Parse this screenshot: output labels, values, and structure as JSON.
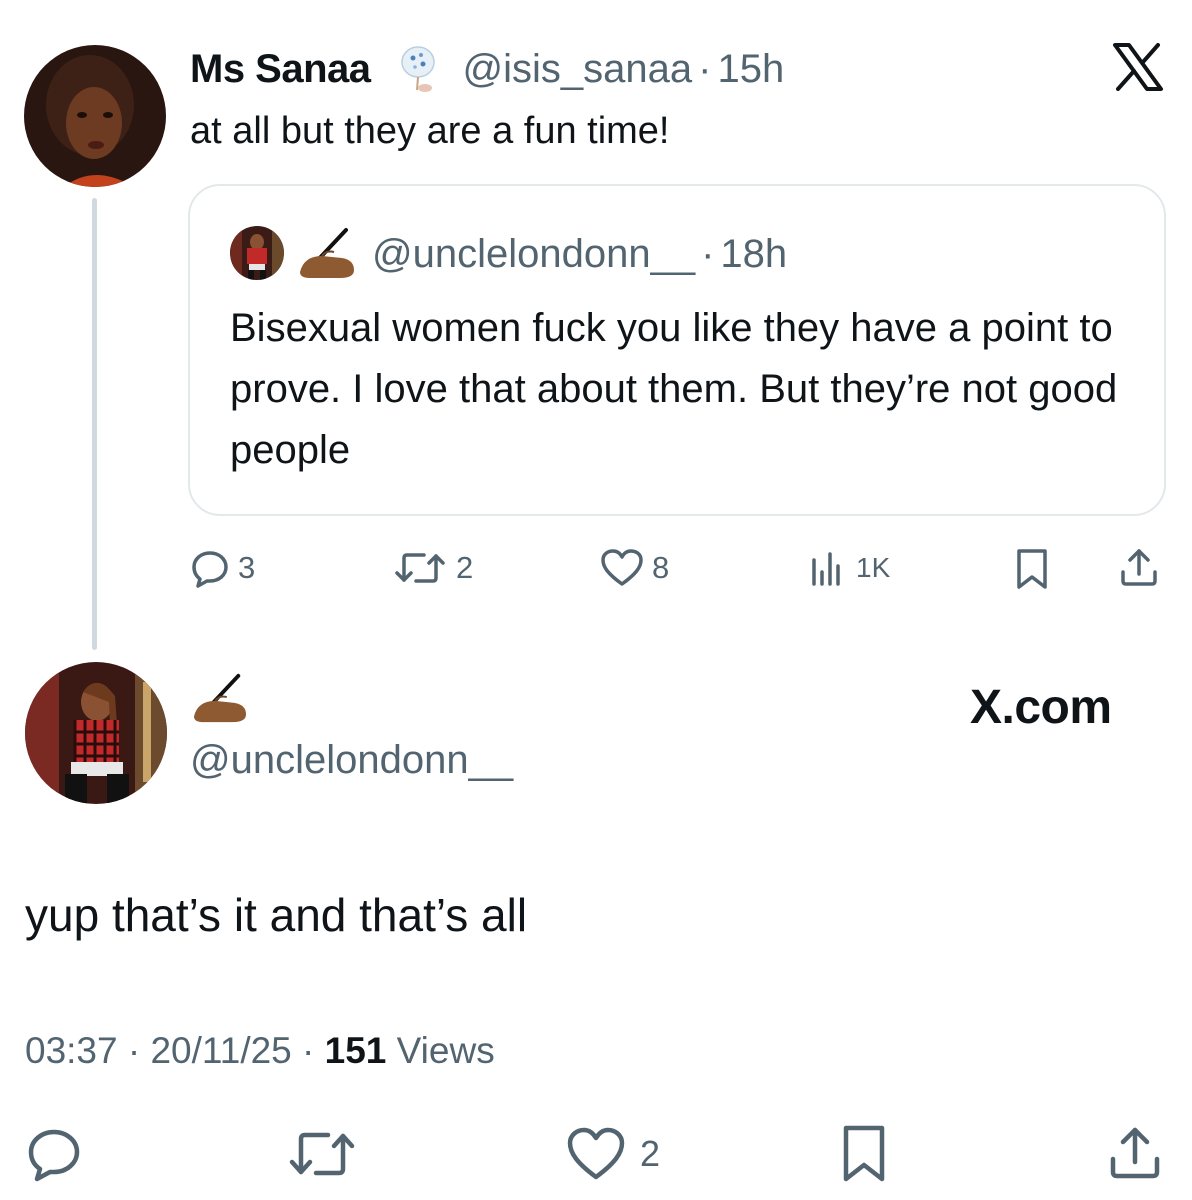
{
  "top_tweet": {
    "display_name": "Ms Sanaa",
    "handle": "@isis_sanaa",
    "time": "15h",
    "text": "at all but they are a fun time!",
    "badge_icon": "porcelain-figure-emoji",
    "quote": {
      "name_icon": "writing-hand-emoji",
      "handle": "@unclelondonn__",
      "time": "18h",
      "text": "Bisexual women fuck you like they have a point to prove. I love that about them. But they’re not good people"
    },
    "actions": {
      "replies": "3",
      "reposts": "2",
      "likes": "8",
      "views": "1K"
    }
  },
  "main_tweet": {
    "name_icon": "writing-hand-emoji",
    "handle": "@unclelondonn__",
    "brand": "X.com",
    "text": "yup that’s it and that’s all",
    "timestamp": "03:37",
    "date": "20/11/25",
    "views_count": "151",
    "views_label": "Views",
    "actions": {
      "likes": "2"
    }
  },
  "colors": {
    "text": "#0f1419",
    "muted": "#536471",
    "border": "#e3e8eb",
    "thread_line": "#cfd9de"
  }
}
